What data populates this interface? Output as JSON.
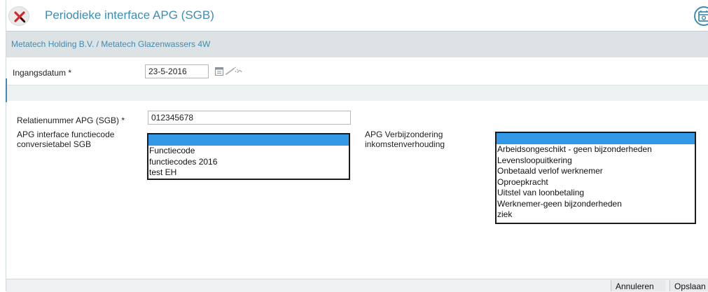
{
  "header": {
    "title": "Periodieke interface APG (SGB)",
    "close_icon": "close-x-icon",
    "right_icon": "calendar-refresh-icon"
  },
  "breadcrumb": "Metatech Holding B.V. / Metatech Glazenwassers 4W",
  "form": {
    "ingangsdatum_label": "Ingangsdatum *",
    "ingangsdatum_value": "23-5-2016",
    "calendar_icon": "calendar-icon",
    "wand_icon": "wand-icon",
    "relatienummer_label": "Relatienummer APG (SGB) *",
    "relatienummer_value": "012345678",
    "functiecode_label_line1": "APG interface functiecode",
    "functiecode_label_line2": "conversietabel SGB",
    "functiecode_options": [
      "Functiecode",
      "functiecodes 2016",
      "test EH"
    ],
    "verbijzondering_label_line1": "APG Verbijzondering",
    "verbijzondering_label_line2": "inkomstenverhouding",
    "verbijzondering_options": [
      "Arbeidsongeschikt - geen bijzonderheden",
      "Levensloopuitkering",
      "Onbetaald verlof werknemer",
      "Oproepkracht",
      "Uitstel van loonbetaling",
      "Werknemer-geen bijzonderheden",
      "ziek"
    ]
  },
  "footer": {
    "cancel_label": "Annuleren",
    "save_label": "Opslaan"
  },
  "colors": {
    "accent": "#3f8cb3",
    "selection": "#3399e6",
    "bar": "#dde2e4"
  }
}
